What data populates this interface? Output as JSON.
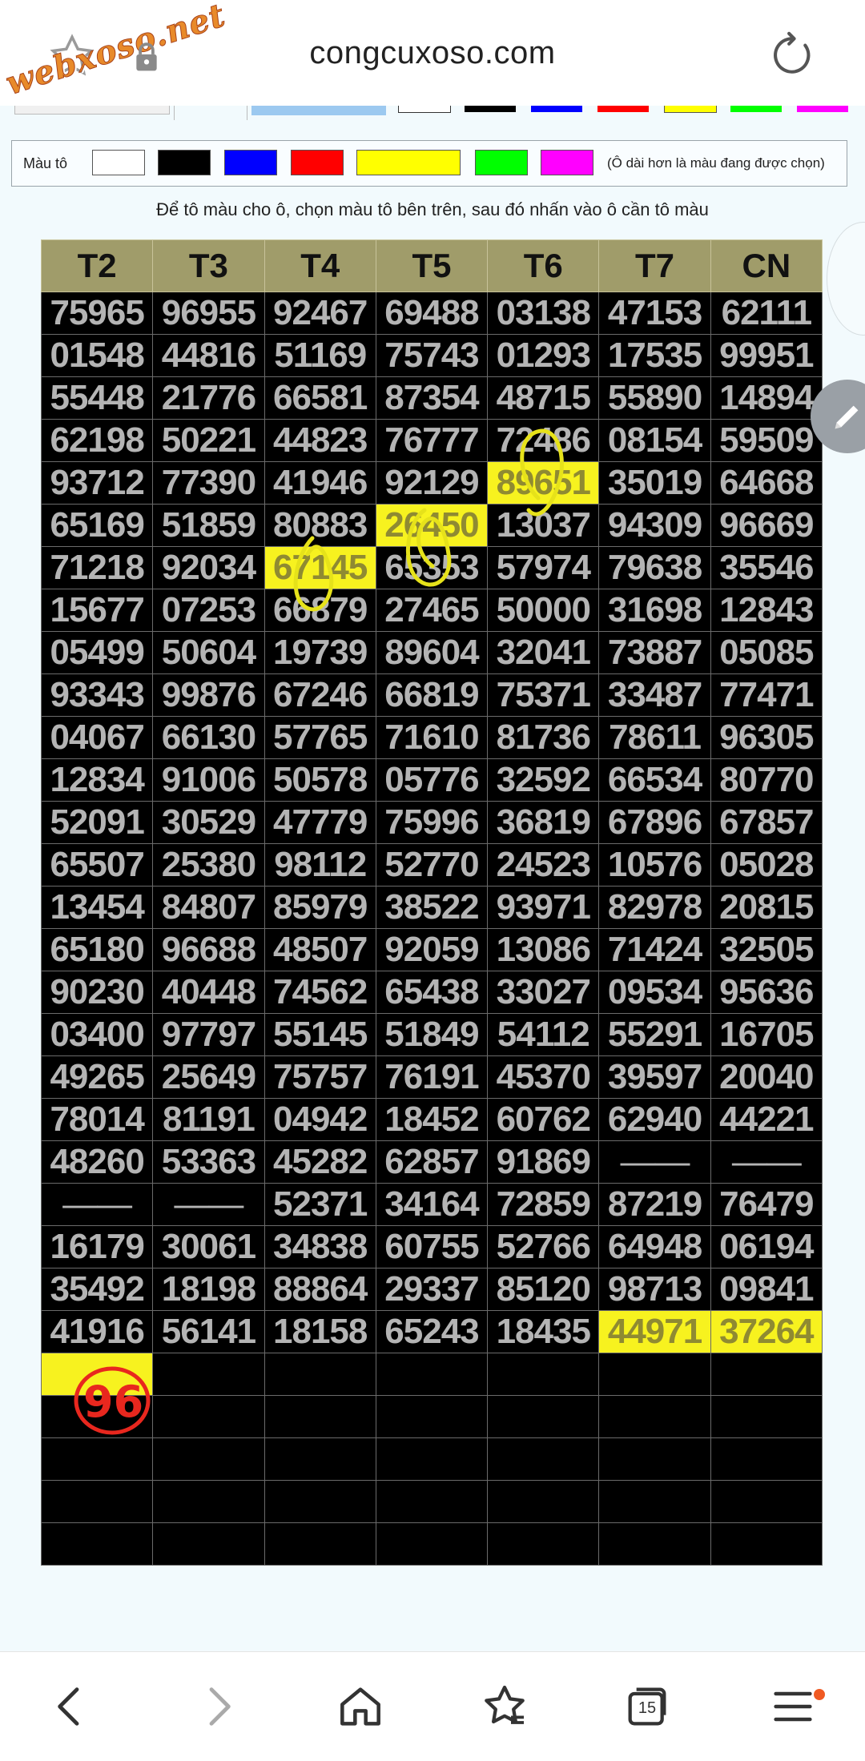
{
  "browser": {
    "watermark": "webxoso.net",
    "domain": "congcuxoso.com",
    "tab_count": "15"
  },
  "palette": {
    "label": "Màu tô",
    "note": "(Ô dài hơn là màu đang được chọn)",
    "colors": [
      "#ffffff",
      "#000000",
      "#0000ff",
      "#ff0000",
      "#ffff00",
      "#00ff00",
      "#ff00ff"
    ],
    "selected": "#ffff00"
  },
  "instruction": "Để tô màu cho ô, chọn màu tô bên trên, sau đó nhấn vào ô cần tô màu",
  "table": {
    "headers": [
      "T2",
      "T3",
      "T4",
      "T5",
      "T6",
      "T7",
      "CN"
    ],
    "rows": [
      [
        "75965",
        "96955",
        "92467",
        "69488",
        "03138",
        "47153",
        "62111"
      ],
      [
        "01548",
        "44816",
        "51169",
        "75743",
        "01293",
        "17535",
        "99951"
      ],
      [
        "55448",
        "21776",
        "66581",
        "87354",
        "48715",
        "55890",
        "14894"
      ],
      [
        "62198",
        "50221",
        "44823",
        "76777",
        "72486",
        "08154",
        "59509"
      ],
      [
        "93712",
        "77390",
        "41946",
        "92129",
        "89651",
        "35019",
        "64668"
      ],
      [
        "65169",
        "51859",
        "80883",
        "26450",
        "13037",
        "94309",
        "96669"
      ],
      [
        "71218",
        "92034",
        "67145",
        "65353",
        "57974",
        "79638",
        "35546"
      ],
      [
        "15677",
        "07253",
        "66879",
        "27465",
        "50000",
        "31698",
        "12843"
      ],
      [
        "05499",
        "50604",
        "19739",
        "89604",
        "32041",
        "73887",
        "05085"
      ],
      [
        "93343",
        "99876",
        "67246",
        "66819",
        "75371",
        "33487",
        "77471"
      ],
      [
        "04067",
        "66130",
        "57765",
        "71610",
        "81736",
        "78611",
        "96305"
      ],
      [
        "12834",
        "91006",
        "50578",
        "05776",
        "32592",
        "66534",
        "80770"
      ],
      [
        "52091",
        "30529",
        "47779",
        "75996",
        "36819",
        "67896",
        "67857"
      ],
      [
        "65507",
        "25380",
        "98112",
        "52770",
        "24523",
        "10576",
        "05028"
      ],
      [
        "13454",
        "84807",
        "85979",
        "38522",
        "93971",
        "82978",
        "20815"
      ],
      [
        "65180",
        "96688",
        "48507",
        "92059",
        "13086",
        "71424",
        "32505"
      ],
      [
        "90230",
        "40448",
        "74562",
        "65438",
        "33027",
        "09534",
        "95636"
      ],
      [
        "03400",
        "97797",
        "55145",
        "51849",
        "54112",
        "55291",
        "16705"
      ],
      [
        "49265",
        "25649",
        "75757",
        "76191",
        "45370",
        "39597",
        "20040"
      ],
      [
        "78014",
        "81191",
        "04942",
        "18452",
        "60762",
        "62940",
        "44221"
      ],
      [
        "48260",
        "53363",
        "45282",
        "62857",
        "91869",
        "——",
        "——"
      ],
      [
        "——",
        "——",
        "52371",
        "34164",
        "72859",
        "87219",
        "76479"
      ],
      [
        "16179",
        "30061",
        "34838",
        "60755",
        "52766",
        "64948",
        "06194"
      ],
      [
        "35492",
        "18198",
        "88864",
        "29337",
        "85120",
        "98713",
        "09841"
      ],
      [
        "41916",
        "56141",
        "18158",
        "65243",
        "18435",
        "44971",
        "37264"
      ],
      [
        "",
        "",
        "",
        "",
        "",
        "",
        ""
      ],
      [
        "",
        "",
        "",
        "",
        "",
        "",
        ""
      ],
      [
        "",
        "",
        "",
        "",
        "",
        "",
        ""
      ],
      [
        "",
        "",
        "",
        "",
        "",
        "",
        ""
      ],
      [
        "",
        "",
        "",
        "",
        "",
        "",
        ""
      ]
    ],
    "highlighted": [
      [
        4,
        4
      ],
      [
        5,
        3
      ],
      [
        6,
        2
      ],
      [
        24,
        5
      ],
      [
        24,
        6
      ],
      [
        25,
        0
      ]
    ]
  },
  "annotation": "96",
  "colors": {
    "header_bg": "#a09c6a",
    "cell_bg": "#000000",
    "cell_text": "#b4b4b4",
    "highlight": "#f7f21f",
    "pen_red": "#e8271e"
  }
}
